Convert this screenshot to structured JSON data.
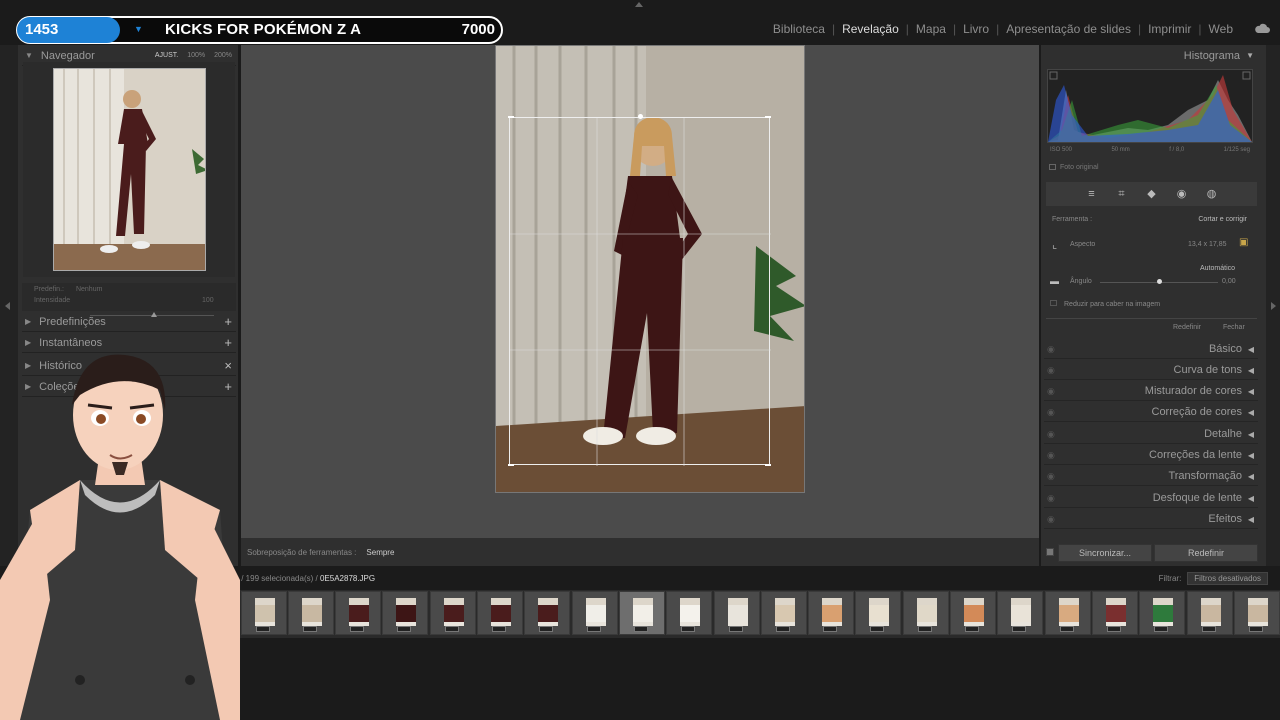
{
  "stream_overlay": {
    "count": "1453",
    "title": "KICKS FOR POKÉMON Z A",
    "score": "7000",
    "accent": "#1e82d6"
  },
  "modules": [
    "Biblioteca",
    "Revelação",
    "Mapa",
    "Livro",
    "Apresentação de slides",
    "Imprimir",
    "Web"
  ],
  "active_module": "Revelação",
  "left_panel": {
    "navigator": {
      "title": "Navegador",
      "options": [
        "AJUST.",
        "100%",
        "200%"
      ]
    },
    "preset_label": "Predefin.:",
    "preset_value": "Nenhum",
    "intensity_label": "Intensidade",
    "intensity_value": "100",
    "sections": [
      {
        "label": "Predefinições",
        "action": "+"
      },
      {
        "label": "Instantâneos",
        "action": "+"
      },
      {
        "label": "Histórico",
        "action": "×"
      },
      {
        "label": "Coleções",
        "action": "+"
      }
    ]
  },
  "toolbar": {
    "label": "Sobreposição de ferramentas :",
    "value": "Sempre"
  },
  "filmstrip": {
    "info_prefix": "9 fotos / 199 selecionada(s) /",
    "filename": "0E5A2878.JPG",
    "filter_label": "Filtrar:",
    "filter_value": "Filtros desativados",
    "cell_count": 27,
    "selected_index": 13
  },
  "right_panel": {
    "histogram_title": "Histograma",
    "exif": [
      "ISO 500",
      "50 mm",
      "f / 8,0",
      "1/125 seg"
    ],
    "original_photo": "Foto original",
    "tool_label": "Ferramenta :",
    "tool_value": "Cortar e corrigir",
    "aspect_label": "Aspecto",
    "aspect_value": "13,4 x 17,85",
    "automatic": "Automático",
    "angle_label": "Ângulo",
    "angle_value": "0,00",
    "constrain_label": "Reduzir para caber na imagem",
    "reset_label": "Redefinir",
    "close_label": "Fechar",
    "sections": [
      "Básico",
      "Curva de tons",
      "Misturador de cores",
      "Correção de cores",
      "Detalhe",
      "Correções da lente",
      "Transformação",
      "Desfoque de lente",
      "Efeitos"
    ],
    "sync_label": "Sincronizar...",
    "reset_button": "Redefinir"
  }
}
